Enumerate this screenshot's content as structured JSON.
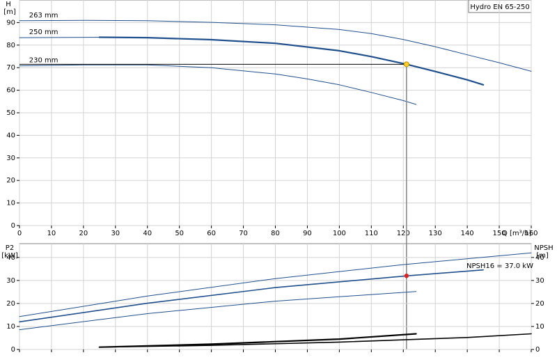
{
  "chart_data": [
    {
      "type": "line",
      "title": "Hydro EN 65-250",
      "ylabel": "H",
      "yunit": "[m]",
      "xlabel": "Q",
      "xunit": "[m³/h]",
      "xlim": [
        0,
        160
      ],
      "ylim": [
        0,
        100
      ],
      "xticks": [
        0,
        10,
        20,
        30,
        40,
        50,
        60,
        70,
        80,
        90,
        100,
        110,
        120,
        130,
        140,
        150,
        160
      ],
      "yticks": [
        0,
        10,
        20,
        30,
        40,
        50,
        60,
        70,
        80,
        90
      ],
      "grid": true,
      "series": [
        {
          "name": "263 mm",
          "color": "#1f4e8c",
          "width": 1,
          "x": [
            0,
            20,
            40,
            60,
            80,
            100,
            110,
            120,
            130,
            140,
            150,
            160
          ],
          "y": [
            90.8,
            91,
            90.8,
            90.1,
            89,
            86.9,
            85.1,
            82.5,
            79.3,
            75.7,
            72.2,
            68.4
          ]
        },
        {
          "name": "250 mm",
          "color": "#1f4e8c",
          "width": 1,
          "x": [
            0,
            25
          ],
          "y": [
            83.3,
            83.5
          ]
        },
        {
          "name": "",
          "color": "#1f4e8c",
          "width": 2.2,
          "x": [
            25,
            40,
            60,
            80,
            100,
            110,
            121,
            130,
            140,
            145
          ],
          "y": [
            83.5,
            83.3,
            82.4,
            80.8,
            77.5,
            74.9,
            71.5,
            68.3,
            64.6,
            62.4
          ]
        },
        {
          "name": "230 mm",
          "color": "#1f4e8c",
          "width": 1,
          "x": [
            0,
            20,
            40,
            60,
            80,
            90,
            100,
            110,
            120,
            124
          ],
          "y": [
            70.8,
            71.2,
            71.2,
            70,
            67.2,
            65,
            62.4,
            59,
            55.4,
            53.7
          ]
        }
      ],
      "operating_point": {
        "x": 121,
        "y": 71.5,
        "color": "#ffd21f"
      }
    },
    {
      "type": "line",
      "ylabel": "P2",
      "yunit": "[kW]",
      "ylabel_right": "NPSH",
      "yunit_right": "[m]",
      "xlim": [
        0,
        160
      ],
      "ylim": [
        0,
        46
      ],
      "yticks": [
        0,
        10,
        20,
        30,
        40
      ],
      "annotation": "NPSH16 = 37.0 kW",
      "annotation_point": {
        "x": 172,
        "y": 37,
        "color": "#000000"
      },
      "power_series": [
        {
          "name": "",
          "color": "#1f4e8c",
          "width": 1,
          "x": [
            0,
            40,
            80,
            120,
            160
          ],
          "y": [
            14.3,
            23.2,
            30.8,
            36.9,
            42
          ]
        },
        {
          "name": "",
          "color": "#1f4e8c",
          "width": 1.6,
          "x": [
            0,
            40,
            80,
            121,
            145
          ],
          "y": [
            12,
            20.1,
            26.9,
            32,
            34.6
          ]
        },
        {
          "name": "",
          "color": "#1f4e8c",
          "width": 1,
          "x": [
            0,
            40,
            80,
            124
          ],
          "y": [
            8.6,
            15.6,
            21,
            25.2
          ]
        }
      ],
      "operating_point": {
        "x": 121,
        "y": 32,
        "color": "#e02020"
      },
      "npsh_series": [
        {
          "name": "",
          "color": "#000000",
          "width": 2.2,
          "x": [
            25,
            60,
            100,
            124
          ],
          "y": [
            1,
            2.3,
            4.5,
            6.8
          ]
        },
        {
          "name": "",
          "color": "#000000",
          "width": 1.6,
          "x": [
            25,
            60,
            100,
            140,
            160
          ],
          "y": [
            1,
            1.8,
            3.2,
            5.2,
            6.8
          ]
        }
      ]
    }
  ]
}
